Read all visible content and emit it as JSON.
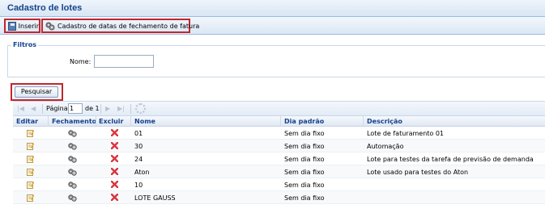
{
  "window": {
    "title": "Cadastro de lotes"
  },
  "toolbar": {
    "insert_label": "Inserir",
    "fechamento_label": "Cadastro de datas de fechamento de fatura"
  },
  "filters": {
    "legend": "Filtros",
    "nome_label": "Nome:",
    "nome_value": ""
  },
  "search": {
    "label": "Pesquisar"
  },
  "pager": {
    "page_label": "Página",
    "current_page": "1",
    "of_label": "de 1"
  },
  "grid": {
    "columns": [
      "Editar",
      "Fechamento",
      "Excluir",
      "Nome",
      "Dia padrão",
      "Descrição"
    ],
    "rows": [
      {
        "nome": "01",
        "dia": "Sem dia fixo",
        "descricao": "Lote de faturamento 01"
      },
      {
        "nome": "30",
        "dia": "Sem dia fixo",
        "descricao": "Automação"
      },
      {
        "nome": "24",
        "dia": "Sem dia fixo",
        "descricao": "Lote para testes da tarefa de previsão de demanda"
      },
      {
        "nome": "Aton",
        "dia": "Sem dia fixo",
        "descricao": "Lote usado para testes do Aton"
      },
      {
        "nome": "10",
        "dia": "Sem dia fixo",
        "descricao": ""
      },
      {
        "nome": "LOTE GAUSS",
        "dia": "Sem dia fixo",
        "descricao": ""
      }
    ]
  },
  "icons": {
    "edit": "edit-icon",
    "fechamento": "gears-icon",
    "delete": "delete-x-icon",
    "save": "save-icon",
    "refresh": "refresh-icon"
  },
  "colors": {
    "title": "#15428b",
    "highlight_border": "#c0272d",
    "delete": "#d9363e"
  }
}
